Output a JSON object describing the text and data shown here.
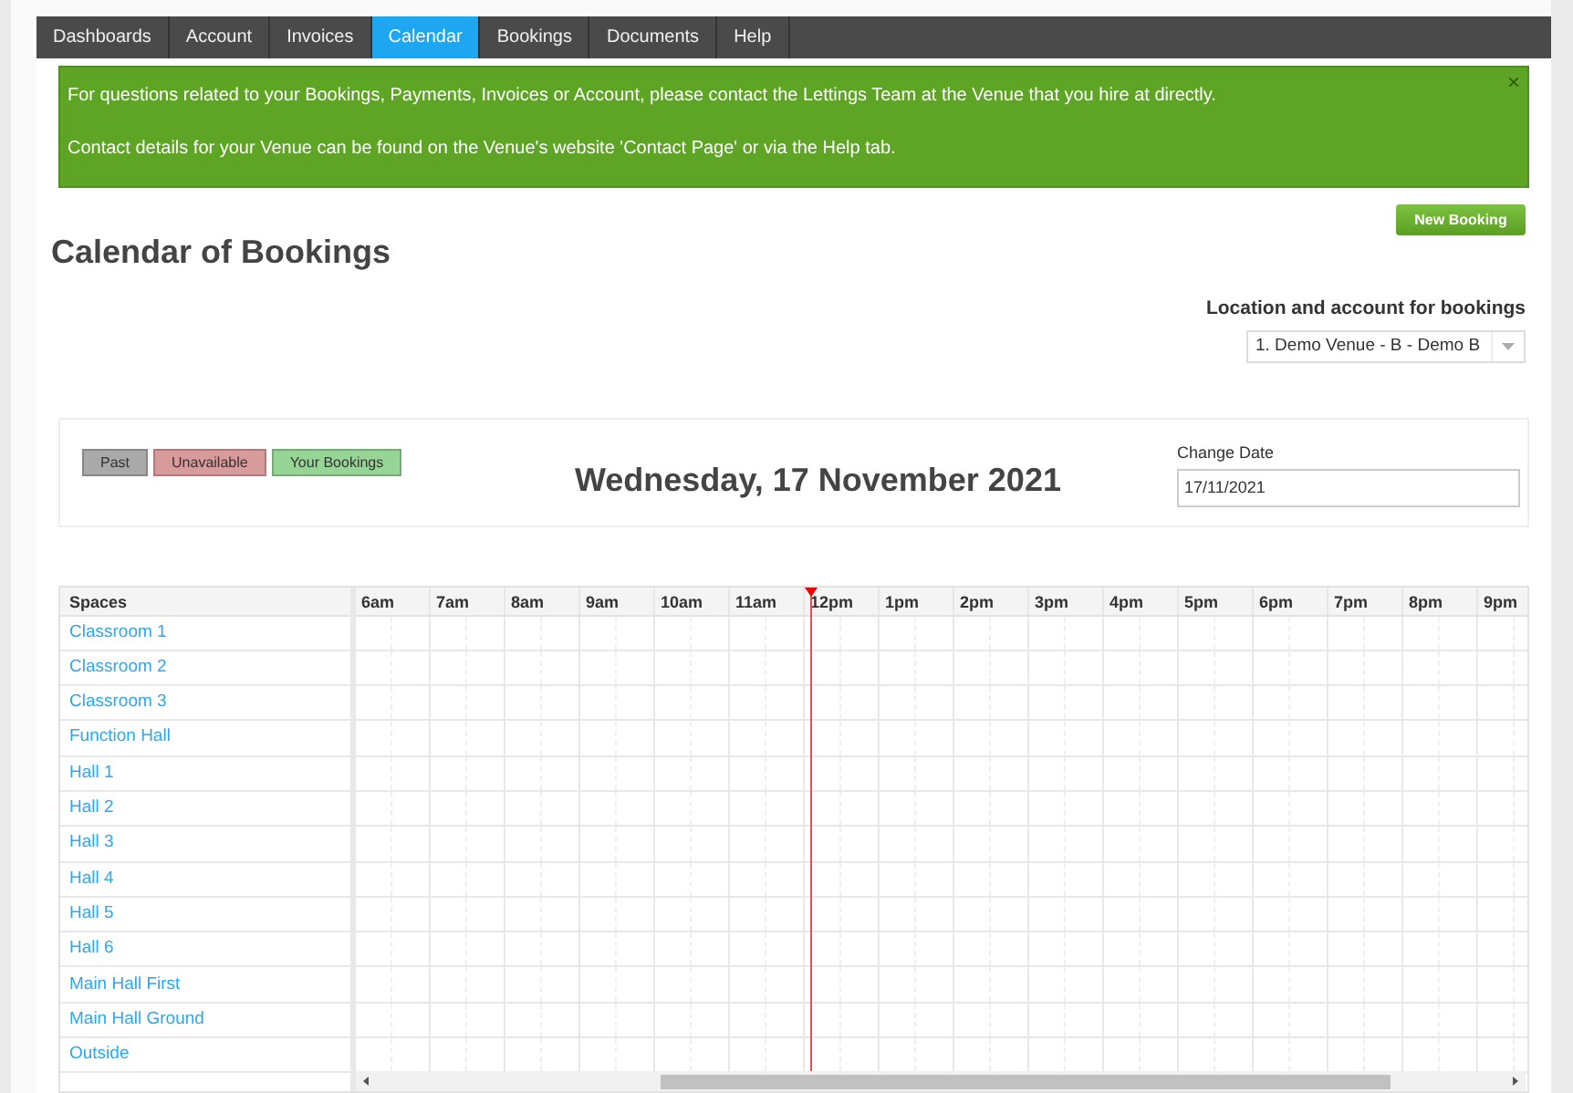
{
  "nav": [
    {
      "label": "Dashboards",
      "selected": false
    },
    {
      "label": "Account",
      "selected": false
    },
    {
      "label": "Invoices",
      "selected": false
    },
    {
      "label": "Calendar",
      "selected": true
    },
    {
      "label": "Bookings",
      "selected": false
    },
    {
      "label": "Documents",
      "selected": false
    },
    {
      "label": "Help",
      "selected": false
    }
  ],
  "alert": {
    "lines": [
      "For questions related to your Bookings, Payments, Invoices or Account, please contact the Lettings Team at the Venue that you hire at directly.",
      "Contact details for your Venue can be found on the Venue's website 'Contact Page' or via the Help tab."
    ],
    "close": "×"
  },
  "title": "Calendar of Bookings",
  "new_booking_button": "New Booking",
  "location": {
    "label": "Location and account for bookings",
    "value": "1. Demo Venue - B - Demo B"
  },
  "legend": [
    {
      "label": "Past",
      "color": "#a9a9a9"
    },
    {
      "label": "Unavailable",
      "color": "#d99a9c"
    },
    {
      "label": "Your Bookings",
      "color": "#96d596"
    }
  ],
  "date_heading": "Wednesday, 17 November 2021",
  "change_date": {
    "label": "Change Date",
    "value": "17/11/2021"
  },
  "grid": {
    "spaces_header": "Spaces",
    "hours": [
      "6am",
      "7am",
      "8am",
      "9am",
      "10am",
      "11am",
      "12pm",
      "1pm",
      "2pm",
      "3pm",
      "4pm",
      "5pm",
      "6pm",
      "7pm",
      "8pm",
      "9pm"
    ],
    "spaces": [
      "Classroom 1",
      "Classroom 2",
      "Classroom 3",
      "Function Hall",
      "Hall 1",
      "Hall 2",
      "Hall 3",
      "Hall 4",
      "Hall 5",
      "Hall 6",
      "Main Hall First",
      "Main Hall Ground",
      "Outside"
    ]
  }
}
